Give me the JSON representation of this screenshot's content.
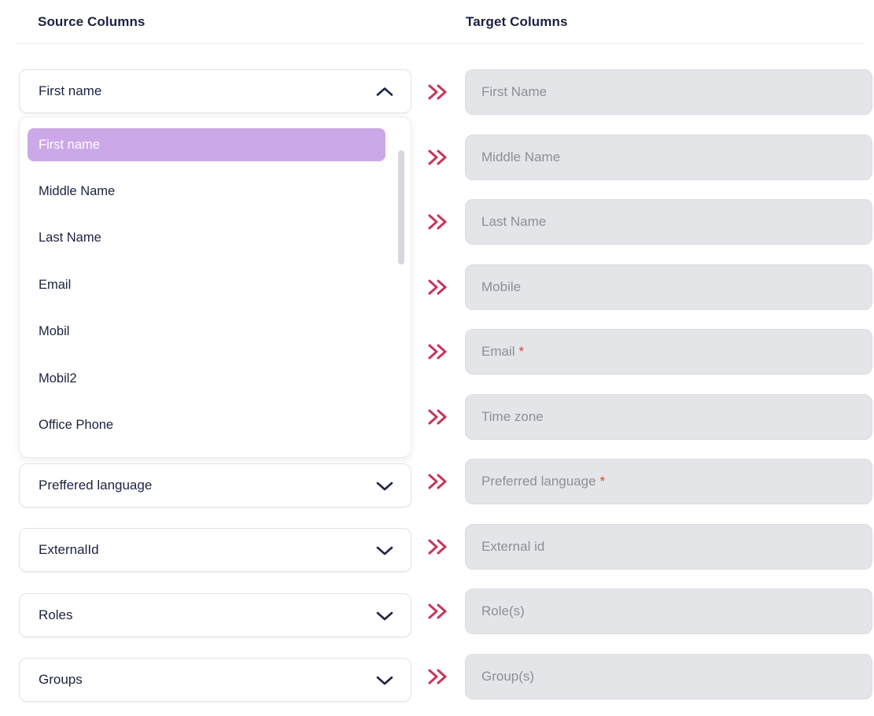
{
  "headers": {
    "source": "Source Columns",
    "target": "Target Columns"
  },
  "colors": {
    "accent_arrow": "#c8365c",
    "option_selected_bg": "#cca8e9",
    "required_asterisk": "#e0402a",
    "text_primary": "#1b2240",
    "target_field_bg": "#e4e5e9",
    "placeholder_text": "#8d8f96"
  },
  "source_column": {
    "selects": [
      {
        "value": "First name",
        "state": "open",
        "icon": "chevron-up-icon"
      },
      {
        "value": "Preffered language",
        "state": "closed",
        "icon": "chevron-down-icon"
      },
      {
        "value": "ExternalId",
        "state": "closed",
        "icon": "chevron-down-icon"
      },
      {
        "value": "Roles",
        "state": "closed",
        "icon": "chevron-down-icon"
      },
      {
        "value": "Groups",
        "state": "closed",
        "icon": "chevron-down-icon"
      }
    ],
    "open_dropdown": {
      "selected": "First name",
      "options": [
        "First name",
        "Middle Name",
        "Last Name",
        "Email",
        "Mobil",
        "Mobil2",
        "Office Phone"
      ]
    }
  },
  "target_column": {
    "fields": [
      {
        "placeholder": "First Name",
        "required": false
      },
      {
        "placeholder": "Middle Name",
        "required": false
      },
      {
        "placeholder": "Last Name",
        "required": false
      },
      {
        "placeholder": "Mobile",
        "required": false
      },
      {
        "placeholder": "Email",
        "required": true
      },
      {
        "placeholder": "Time zone",
        "required": false
      },
      {
        "placeholder": "Preferred language",
        "required": true
      },
      {
        "placeholder": "External id",
        "required": false
      },
      {
        "placeholder": "Role(s)",
        "required": false
      },
      {
        "placeholder": "Group(s)",
        "required": false
      }
    ],
    "required_marker": "*"
  },
  "arrows": {
    "count": 10,
    "icon": "double-chevron-right-icon"
  }
}
